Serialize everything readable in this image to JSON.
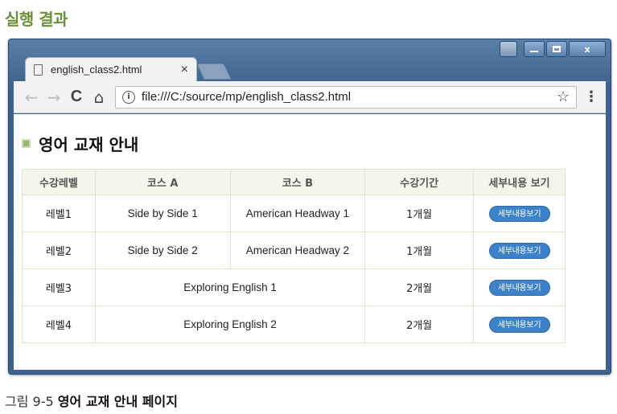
{
  "document": {
    "heading": "실행 결과",
    "caption_label": "그림 9-5",
    "caption_title": "영어 교재 안내 페이지"
  },
  "browser": {
    "window_controls": {
      "minimize": "–",
      "maximize": "□",
      "close": "x"
    },
    "tab": {
      "title": "english_class2.html",
      "close_glyph": "×"
    },
    "toolbar": {
      "back_glyph": "←",
      "forward_glyph": "→",
      "reload_glyph": "C",
      "home_glyph": "⌂",
      "info_glyph": "i",
      "url": "file:///C:/source/mp/english_class2.html",
      "star_glyph": "☆",
      "menu_glyph": "⋮"
    }
  },
  "page": {
    "title": "영어 교재 안내",
    "table": {
      "headers": [
        "수강레벨",
        "코스 A",
        "코스 B",
        "수강기간",
        "세부내용 보기"
      ],
      "rows": [
        {
          "level": "레벨1",
          "course_a": "Side by Side 1",
          "course_b": "American Headway 1",
          "period": "1개월",
          "button": "세부내용보기"
        },
        {
          "level": "레벨2",
          "course_a": "Side by Side 2",
          "course_b": "American Headway 2",
          "period": "1개월",
          "button": "세부내용보기"
        },
        {
          "level": "레벨3",
          "course_merged": "Exploring English 1",
          "period": "2개월",
          "button": "세부내용보기"
        },
        {
          "level": "레벨4",
          "course_merged": "Exploring English 2",
          "period": "2개월",
          "button": "세부내용보기"
        }
      ]
    }
  },
  "colors": {
    "heading_green": "#6b8f3a",
    "window_frame": "#3e628d",
    "button_blue": "#3d82c8",
    "table_header_bg": "#f5f5ec",
    "table_border": "#dfe6cf"
  }
}
